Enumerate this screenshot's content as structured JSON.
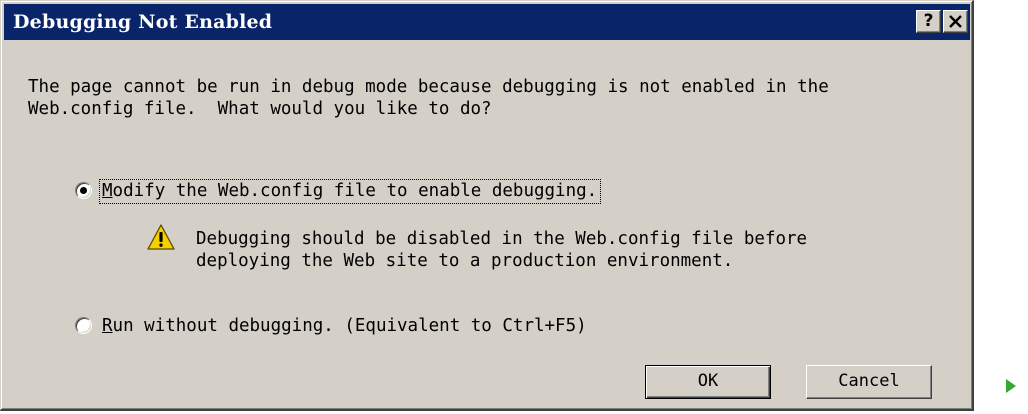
{
  "window": {
    "title": "Debugging Not Enabled",
    "help_button": "?",
    "close_button": "✕"
  },
  "message": {
    "line1": "The page cannot be run in debug mode because debugging is not enabled in the",
    "line2": "Web.config file.  What would you like to do?"
  },
  "options": [
    {
      "selected": true,
      "accesskey": "M",
      "label_rest": "odify the Web.config file to enable debugging."
    },
    {
      "selected": false,
      "accesskey": "R",
      "label_rest": "un without debugging. (Equivalent to Ctrl+F5)"
    }
  ],
  "warning": {
    "icon": "warning-icon",
    "line1": "Debugging should be disabled in the Web.config file before",
    "line2": "deploying the Web site to a production environment."
  },
  "buttons": {
    "ok": "OK",
    "cancel": "Cancel"
  },
  "colors": {
    "titlebar": "#0a246a",
    "dialog_face": "#d4d0c8",
    "warning_yellow": "#f5d000",
    "play_green": "#33a833"
  },
  "side_icon": "play-arrow-icon"
}
